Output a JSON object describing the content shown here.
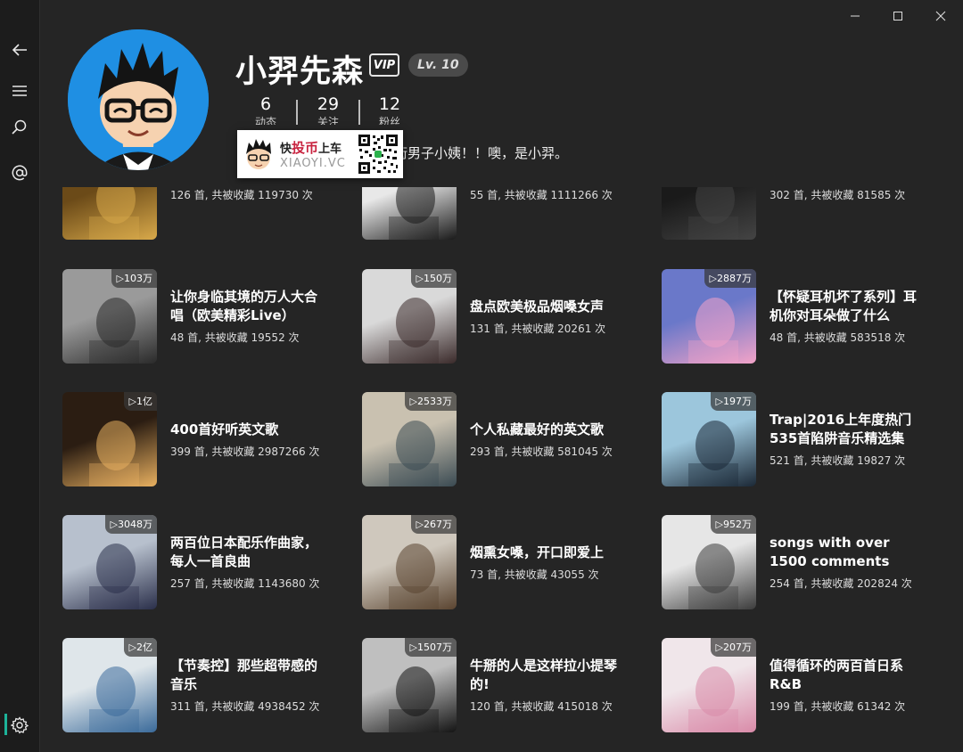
{
  "sidebar": {
    "items": [
      "back-arrow-icon",
      "menu-icon",
      "search-icon",
      "at-icon"
    ],
    "settings_icon": "gear-icon",
    "accent_color": "#1db39a"
  },
  "window_controls": {
    "minimize": "—",
    "maximize": "☐",
    "close": "✕"
  },
  "profile": {
    "username": "小羿先森",
    "vip_badge": "VIP",
    "level": "Lv. 10",
    "stats": [
      {
        "value": "6",
        "label": "动态"
      },
      {
        "value": "29",
        "label": "关注"
      },
      {
        "value": "12",
        "label": "粉丝"
      }
    ],
    "bio": "街男子小姨！！噢，是小羿。"
  },
  "watermark": {
    "brand_pre": "快",
    "brand_highlight": "投币",
    "brand_post": "上车",
    "domain": "XIAOYI.VC"
  },
  "playlists": [
    {
      "title": "",
      "subtitle": "126 首, 共被收藏 119730 次",
      "cover_color": "#6b4a18",
      "cover_accent": "#d8a94a"
    },
    {
      "title": "",
      "subtitle": "55 首, 共被收藏 1111266 次",
      "cover_color": "#e8e8e8",
      "cover_accent": "#1a1a1a"
    },
    {
      "title": "",
      "subtitle": "302 首, 共被收藏 81585 次",
      "cover_color": "#1a1a1a",
      "cover_accent": "#444444"
    },
    {
      "play_count": "▷103万",
      "title": "让你身临其境的万人大合唱（欧美精彩Live）",
      "subtitle": "48 首, 共被收藏 19552 次",
      "cover_color": "#9a9a9a",
      "cover_accent": "#2a2a2a"
    },
    {
      "play_count": "▷150万",
      "title": "盘点欧美极品烟嗓女声",
      "subtitle": "131 首, 共被收藏 20261 次",
      "cover_color": "#d9d9d9",
      "cover_accent": "#3a2a2a"
    },
    {
      "play_count": "▷2887万",
      "title": "【怀疑耳机坏了系列】耳机你对耳朵做了什么",
      "subtitle": "48 首, 共被收藏 583518 次",
      "cover_color": "#6a78c9",
      "cover_accent": "#f3a3c8"
    },
    {
      "play_count": "▷1亿",
      "title": "400首好听英文歌",
      "subtitle": "399 首, 共被收藏 2987266 次",
      "cover_color": "#2b1d12",
      "cover_accent": "#e8b060"
    },
    {
      "play_count": "▷2533万",
      "title": "个人私藏最好的英文歌",
      "subtitle": "293 首, 共被收藏 581045 次",
      "cover_color": "#c9c1b0",
      "cover_accent": "#3a4a52"
    },
    {
      "play_count": "▷197万",
      "title": "Trap|2016上年度热门535首陷阱音乐精选集",
      "subtitle": "521 首, 共被收藏 19827 次",
      "cover_color": "#9cc6dc",
      "cover_accent": "#1b2836"
    },
    {
      "play_count": "▷3048万",
      "title": "两百位日本配乐作曲家，每人一首良曲",
      "subtitle": "257 首, 共被收藏 1143680 次",
      "cover_color": "#b7c0cd",
      "cover_accent": "#2a2f4a"
    },
    {
      "play_count": "▷267万",
      "title": "烟熏女嗓，开口即爱上",
      "subtitle": "73 首, 共被收藏 43055 次",
      "cover_color": "#cfc8bd",
      "cover_accent": "#5a4430"
    },
    {
      "play_count": "▷952万",
      "title": "songs with over 1500 comments",
      "subtitle": "254 首, 共被收藏 202824 次",
      "cover_color": "#e6e6e6",
      "cover_accent": "#3c3c3c"
    },
    {
      "play_count": "▷2亿",
      "title": "【节奏控】那些超带感的音乐",
      "subtitle": "311 首, 共被收藏 4938452 次",
      "cover_color": "#dfe6ea",
      "cover_accent": "#3a6a9a"
    },
    {
      "play_count": "▷1507万",
      "title": "牛掰的人是这样拉小提琴的!",
      "subtitle": "120 首, 共被收藏 415018 次",
      "cover_color": "#bfbfbf",
      "cover_accent": "#141414"
    },
    {
      "play_count": "▷207万",
      "title": "值得循环的两百首日系R&B",
      "subtitle": "199 首, 共被收藏 61342 次",
      "cover_color": "#f0e6ea",
      "cover_accent": "#d98aa8"
    }
  ]
}
